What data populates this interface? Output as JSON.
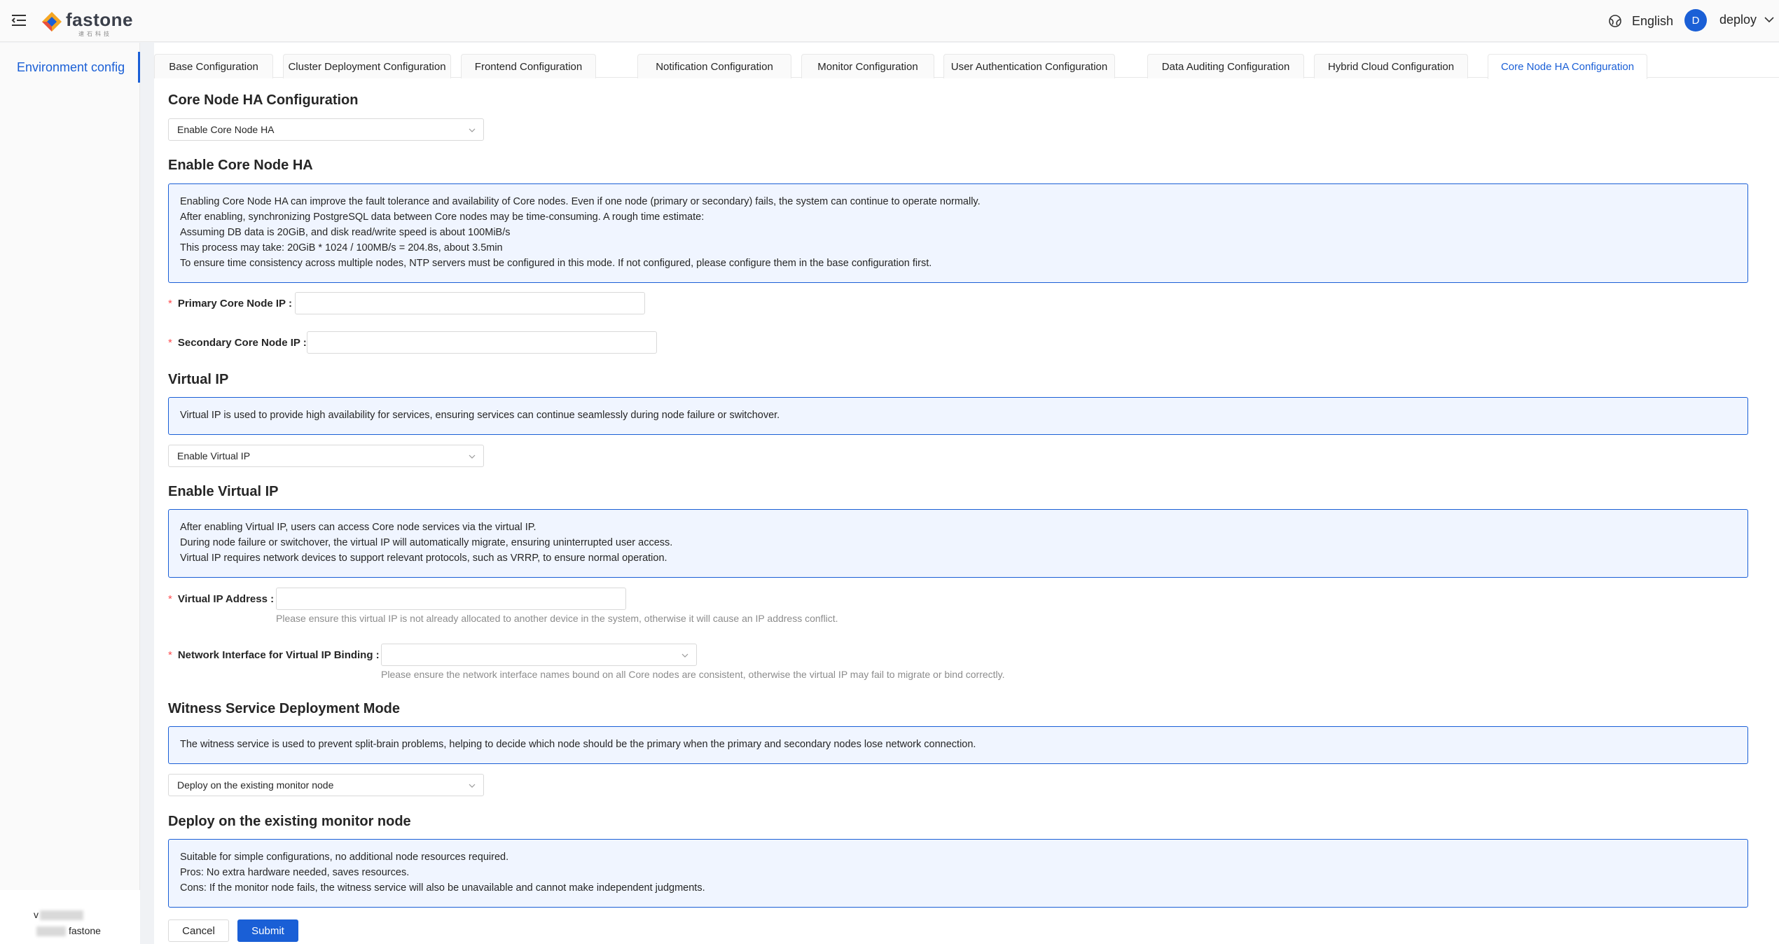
{
  "header": {
    "logo_text": "fastone",
    "logo_sub": "速石科技",
    "language": "English",
    "avatar_initial": "D",
    "user_name": "deploy"
  },
  "sidebar": {
    "items": [
      {
        "label": "Environment config"
      }
    ],
    "version_prefix": "v",
    "brand_suffix": "fastone"
  },
  "tabs": [
    {
      "label": "Base Configuration"
    },
    {
      "label": "Cluster Deployment Configuration"
    },
    {
      "label": "Frontend Configuration"
    },
    {
      "label": "Notification Configuration"
    },
    {
      "label": "Monitor Configuration"
    },
    {
      "label": "User Authentication Configuration"
    },
    {
      "label": "Data Auditing Configuration"
    },
    {
      "label": "Hybrid Cloud Configuration"
    },
    {
      "label": "Core Node HA Configuration",
      "active": true
    }
  ],
  "form": {
    "core_ha": {
      "title": "Core Node HA Configuration",
      "select_value": "Enable Core Node HA"
    },
    "enable_core_ha": {
      "title": "Enable Core Node HA",
      "info": [
        "Enabling Core Node HA can improve the fault tolerance and availability of Core nodes. Even if one node (primary or secondary) fails, the system can continue to operate normally.",
        "After enabling, synchronizing PostgreSQL data between Core nodes may be time-consuming. A rough time estimate:",
        "Assuming DB data is 20GiB, and disk read/write speed is about 100MiB/s",
        "This process may take: 20GiB * 1024 / 100MB/s = 204.8s, about 3.5min",
        "To ensure time consistency across multiple nodes, NTP servers must be configured in this mode. If not configured, please configure them in the base configuration first."
      ],
      "primary_label": "Primary Core Node IP :",
      "primary_value": "",
      "secondary_label": "Secondary Core Node IP :",
      "secondary_value": ""
    },
    "virtual_ip": {
      "title": "Virtual IP",
      "info": "Virtual IP is used to provide high availability for services, ensuring services can continue seamlessly during node failure or switchover.",
      "select_value": "Enable Virtual IP"
    },
    "enable_virtual_ip": {
      "title": "Enable Virtual IP",
      "info": [
        "After enabling Virtual IP, users can access Core node services via the virtual IP.",
        "During node failure or switchover, the virtual IP will automatically migrate, ensuring uninterrupted user access.",
        "Virtual IP requires network devices to support relevant protocols, such as VRRP, to ensure normal operation."
      ],
      "address_label": "Virtual IP Address :",
      "address_value": "",
      "address_hint": "Please ensure this virtual IP is not already allocated to another device in the system, otherwise it will cause an IP address conflict.",
      "nic_label": "Network Interface for Virtual IP Binding :",
      "nic_value": "",
      "nic_hint": "Please ensure the network interface names bound on all Core nodes are consistent, otherwise the virtual IP may fail to migrate or bind correctly."
    },
    "witness": {
      "title": "Witness Service Deployment Mode",
      "info": "The witness service is used to prevent split-brain problems, helping to decide which node should be the primary when the primary and secondary nodes lose network connection.",
      "select_value": "Deploy on the existing monitor node"
    },
    "deploy_existing": {
      "title": "Deploy on the existing monitor node",
      "info": [
        "Suitable for simple configurations, no additional node resources required.",
        "Pros: No extra hardware needed, saves resources.",
        "Cons: If the monitor node fails, the witness service will also be unavailable and cannot make independent judgments."
      ]
    },
    "cancel_label": "Cancel",
    "submit_label": "Submit"
  }
}
